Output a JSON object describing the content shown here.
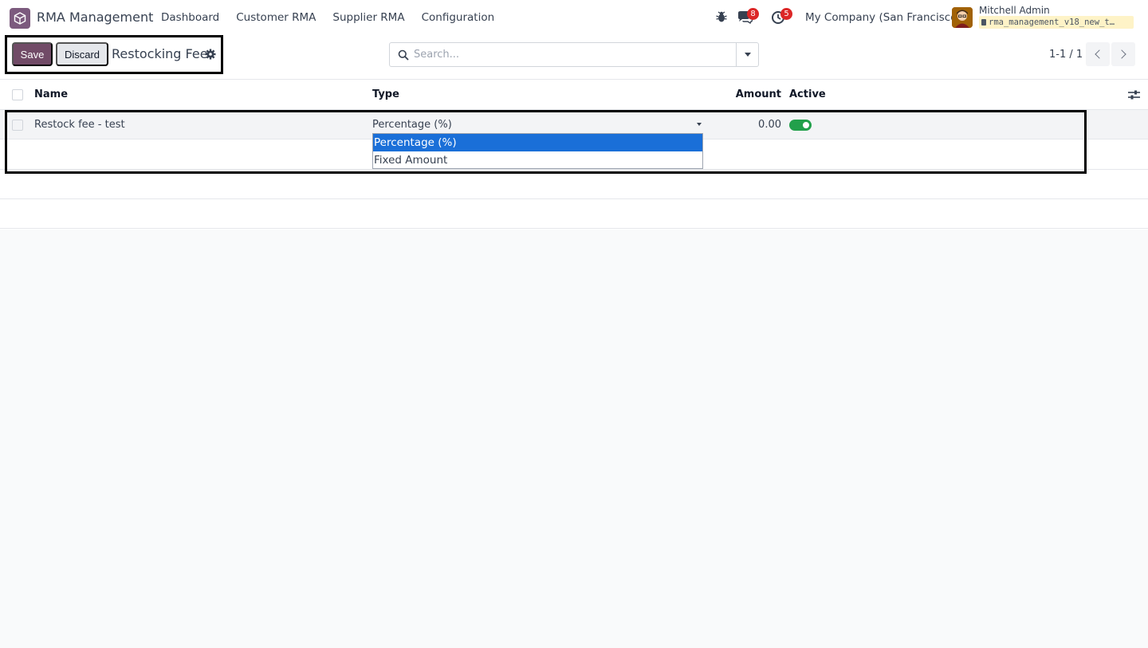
{
  "navbar": {
    "app_name": "RMA Management",
    "menu": [
      "Dashboard",
      "Customer RMA",
      "Supplier RMA",
      "Configuration"
    ],
    "messages_count": "8",
    "activities_count": "5",
    "company": "My Company (San Francisco)",
    "user_name": "Mitchell Admin",
    "database": "rma_management_v18_new_t…"
  },
  "control": {
    "save_label": "Save",
    "discard_label": "Discard",
    "title": "Restocking Fee",
    "search_placeholder": "Search...",
    "pager": "1-1 / 1"
  },
  "list": {
    "columns": {
      "name": "Name",
      "type": "Type",
      "amount": "Amount",
      "active": "Active"
    },
    "rows": [
      {
        "name": "Restock fee - test",
        "type": "Percentage (%)",
        "amount": "0.00",
        "active": true
      }
    ]
  },
  "dropdown": {
    "options": [
      "Percentage (%)",
      "Fixed Amount"
    ],
    "selected": "Percentage (%)"
  },
  "colors": {
    "brand": "#714b67",
    "selected_option": "#1a6fd8",
    "toggle_on": "#22a04b",
    "badge": "#dc2626"
  }
}
